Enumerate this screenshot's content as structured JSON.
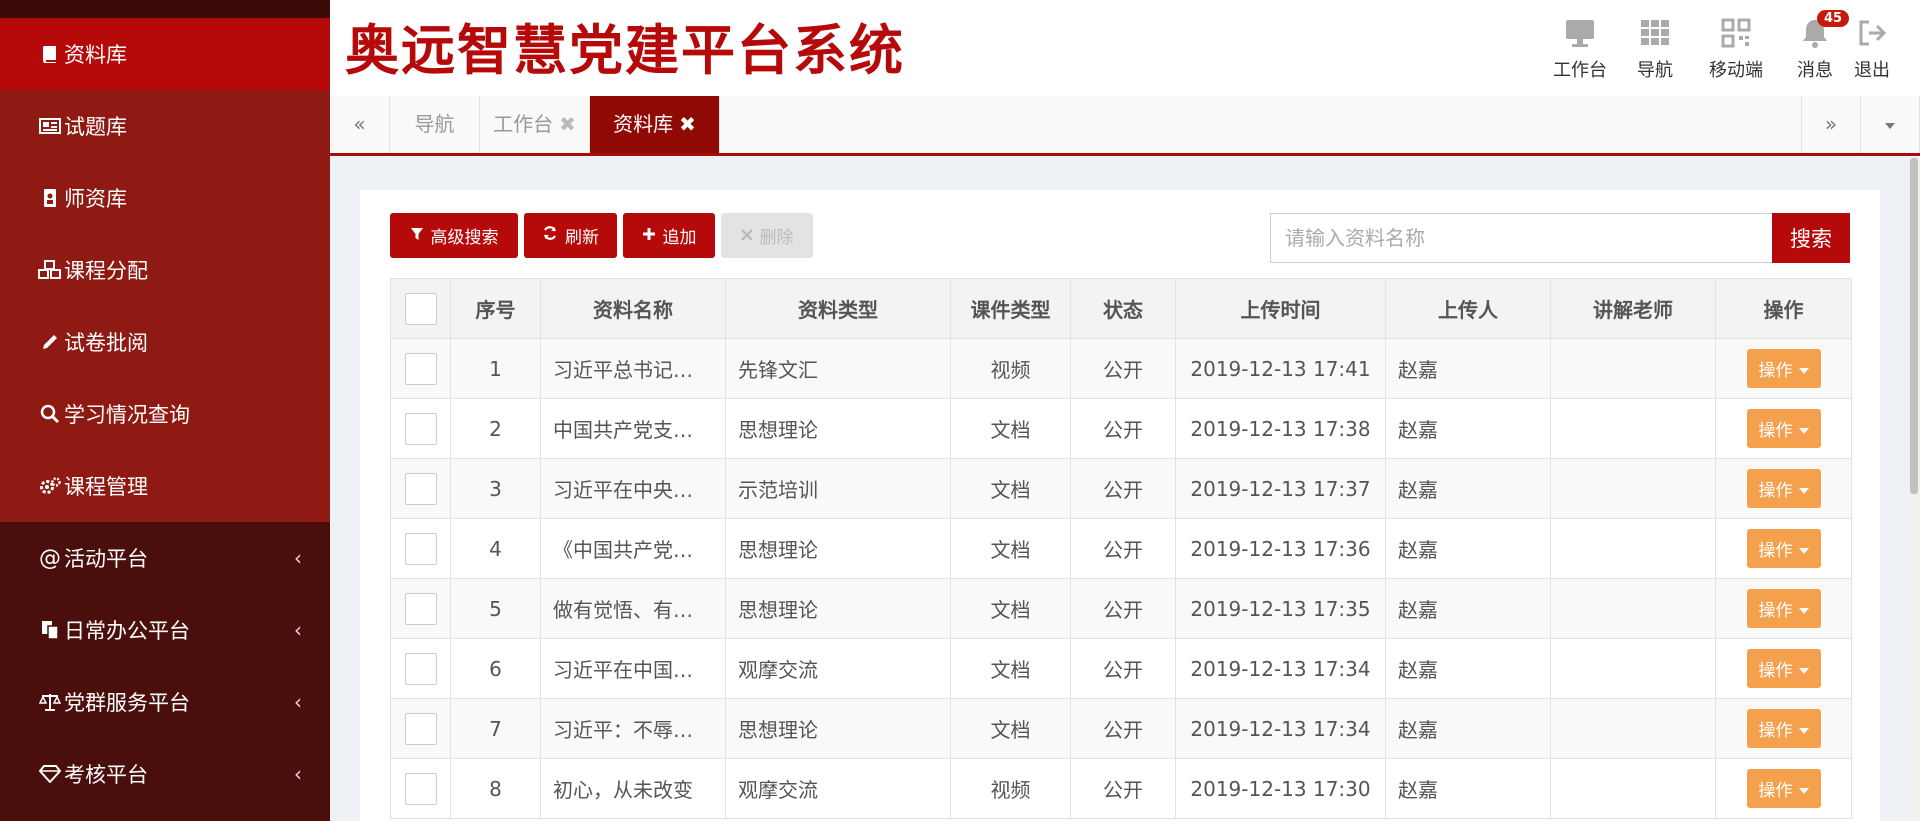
{
  "app": {
    "title": "奥远智慧党建平台系统",
    "accent_color": "#b5090a"
  },
  "header_actions": [
    {
      "label": "工作台",
      "icon": "monitor-icon"
    },
    {
      "label": "导航",
      "icon": "grid-icon"
    },
    {
      "label": "移动端",
      "icon": "qr-code-icon"
    },
    {
      "label": "消息",
      "icon": "bell-icon",
      "badge": "45"
    },
    {
      "label": "退出",
      "icon": "logout-icon"
    }
  ],
  "sidebar": {
    "items": [
      {
        "label": "资料库",
        "icon": "book-icon",
        "active": true
      },
      {
        "label": "试题库",
        "icon": "newspaper-icon"
      },
      {
        "label": "师资库",
        "icon": "id-badge-icon"
      },
      {
        "label": "课程分配",
        "icon": "cubes-icon"
      },
      {
        "label": "试卷批阅",
        "icon": "pencil-icon"
      },
      {
        "label": "学习情况查询",
        "icon": "search-icon"
      },
      {
        "label": "课程管理",
        "icon": "gears-icon"
      },
      {
        "label": "活动平台",
        "icon": "at-icon",
        "expandable": true
      },
      {
        "label": "日常办公平台",
        "icon": "copy-icon",
        "expandable": true
      },
      {
        "label": "党群服务平台",
        "icon": "balance-scale-icon",
        "expandable": true
      },
      {
        "label": "考核平台",
        "icon": "diamond-icon",
        "expandable": true
      }
    ]
  },
  "tabs": {
    "prev": "«",
    "next": "»",
    "items": [
      {
        "label": "导航",
        "closable": false
      },
      {
        "label": "工作台",
        "closable": true
      },
      {
        "label": "资料库",
        "closable": true,
        "active": true
      }
    ],
    "close_glyph": "✖"
  },
  "toolbar": {
    "advanced_search": "高级搜索",
    "refresh": "刷新",
    "add": "追加",
    "delete": "删除"
  },
  "search": {
    "placeholder": "请输入资料名称",
    "button": "搜索"
  },
  "table": {
    "columns": [
      "序号",
      "资料名称",
      "资料类型",
      "课件类型",
      "状态",
      "上传时间",
      "上传人",
      "讲解老师",
      "操作"
    ],
    "action_label": "操作",
    "rows": [
      {
        "no": "1",
        "name": "习近平总书记…",
        "type": "先锋文汇",
        "courseware": "视频",
        "status": "公开",
        "time": "2019-12-13 17:41",
        "uploader": "赵嘉",
        "teacher": ""
      },
      {
        "no": "2",
        "name": "中国共产党支…",
        "type": "思想理论",
        "courseware": "文档",
        "status": "公开",
        "time": "2019-12-13 17:38",
        "uploader": "赵嘉",
        "teacher": ""
      },
      {
        "no": "3",
        "name": "习近平在中央…",
        "type": "示范培训",
        "courseware": "文档",
        "status": "公开",
        "time": "2019-12-13 17:37",
        "uploader": "赵嘉",
        "teacher": ""
      },
      {
        "no": "4",
        "name": "《中国共产党…",
        "type": "思想理论",
        "courseware": "文档",
        "status": "公开",
        "time": "2019-12-13 17:36",
        "uploader": "赵嘉",
        "teacher": ""
      },
      {
        "no": "5",
        "name": "做有觉悟、有…",
        "type": "思想理论",
        "courseware": "文档",
        "status": "公开",
        "time": "2019-12-13 17:35",
        "uploader": "赵嘉",
        "teacher": ""
      },
      {
        "no": "6",
        "name": "习近平在中国…",
        "type": "观摩交流",
        "courseware": "文档",
        "status": "公开",
        "time": "2019-12-13 17:34",
        "uploader": "赵嘉",
        "teacher": ""
      },
      {
        "no": "7",
        "name": "习近平：不辱…",
        "type": "思想理论",
        "courseware": "文档",
        "status": "公开",
        "time": "2019-12-13 17:34",
        "uploader": "赵嘉",
        "teacher": ""
      },
      {
        "no": "8",
        "name": "初心，从未改变",
        "type": "观摩交流",
        "courseware": "视频",
        "status": "公开",
        "time": "2019-12-13 17:30",
        "uploader": "赵嘉",
        "teacher": ""
      }
    ]
  }
}
